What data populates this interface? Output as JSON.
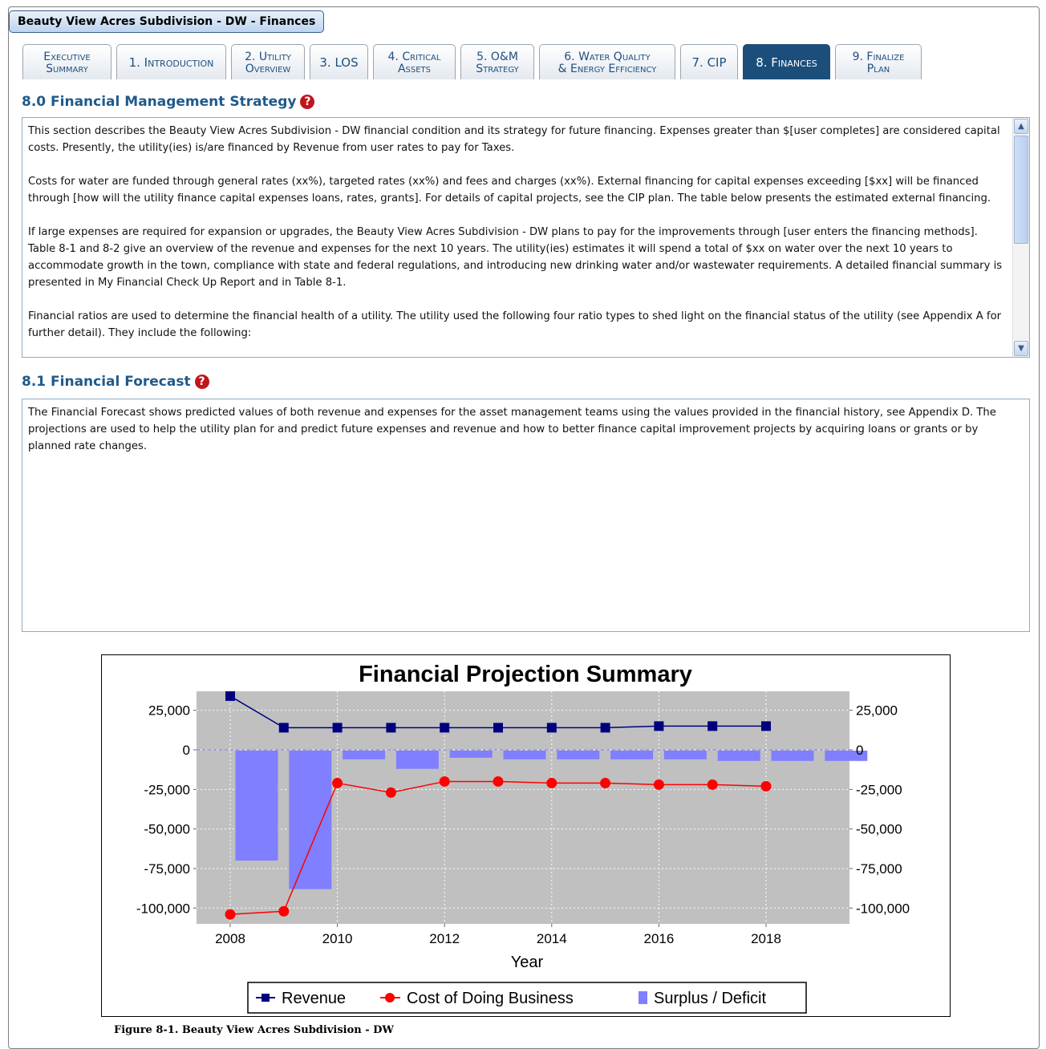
{
  "window": {
    "title": "Beauty View Acres Subdivision - DW - Finances"
  },
  "tabs": [
    {
      "line1": "Executive",
      "line2": "Summary"
    },
    {
      "line1": "1. Introduction",
      "line2": ""
    },
    {
      "line1": "2. Utility",
      "line2": "Overview"
    },
    {
      "line1": "3. LOS",
      "line2": ""
    },
    {
      "line1": "4. Critical",
      "line2": "Assets"
    },
    {
      "line1": "5. O&M",
      "line2": "Strategy"
    },
    {
      "line1": "6. Water Quality",
      "line2": "& Energy Efficiency"
    },
    {
      "line1": "7. CIP",
      "line2": ""
    },
    {
      "line1": "8. Finances",
      "line2": ""
    },
    {
      "line1": "9. Finalize",
      "line2": "Plan"
    }
  ],
  "active_tab": "8. Finances",
  "section_80": {
    "heading": "8.0 Financial Management Strategy",
    "paragraphs": [
      "This section describes the Beauty View Acres Subdivision - DW financial condition and its strategy for future financing. Expenses greater than $[user completes] are considered capital costs. Presently, the utility(ies) is/are financed by Revenue from user rates to pay for Taxes.",
      "Costs for water are funded through general rates (xx%), targeted rates (xx%) and fees and charges (xx%). External financing for capital expenses exceeding [$xx] will be financed through [how will the utility finance capital expenses loans, rates, grants]. For details of capital projects, see the CIP plan. The table below presents the estimated external financing.",
      "If large expenses are required for expansion or upgrades, the Beauty View Acres Subdivision - DW plans to pay for the improvements through [user enters the financing methods]. Table 8-1 and 8-2 give an overview of the revenue and expenses for the next 10 years. The utility(ies) estimates it will spend a total of $xx on water over the next 10 years to accommodate growth in the town, compliance with state and federal regulations, and introducing new drinking water and/or wastewater requirements. A detailed financial summary is presented in My Financial Check Up Report and in Table 8-1.",
      "Financial ratios are used to determine the financial health of a utility. The utility used the following four ratio types to shed light on the financial status of the utility (see Appendix A for further detail). They include the following:"
    ]
  },
  "section_81": {
    "heading": "8.1 Financial Forecast",
    "paragraph": "The Financial Forecast shows predicted values of both revenue and expenses for the asset management teams using the values provided in the financial history, see Appendix D. The projections are used to help the utility plan for and predict future expenses and revenue and how to better finance capital improvement projects by acquiring loans or grants or by planned rate changes."
  },
  "chart_data": {
    "type": "line",
    "title": "Financial Projection Summary",
    "xlabel": "Year",
    "ylabel": "",
    "xlim": [
      2008,
      2019.3
    ],
    "ylim": [
      -110000,
      37000
    ],
    "x_ticks": [
      2008,
      2010,
      2012,
      2014,
      2016,
      2018
    ],
    "y_ticks": [
      25000,
      0,
      -25000,
      -50000,
      -75000,
      -100000
    ],
    "y_tick_labels": [
      "25,000",
      "0",
      "-25,000",
      "-50,000",
      "-75,000",
      "-100,000"
    ],
    "secondary_y_axis": true,
    "grid": true,
    "plot_background": "#c0c0c0",
    "legend_position": "bottom",
    "series": [
      {
        "name": "Revenue",
        "kind": "line",
        "marker": "square",
        "color": "#00007f",
        "x": [
          2008,
          2009,
          2010,
          2011,
          2012,
          2013,
          2014,
          2015,
          2016,
          2017,
          2018
        ],
        "values": [
          34000,
          14000,
          14000,
          14000,
          14000,
          14000,
          14000,
          14000,
          15000,
          15000,
          15000
        ]
      },
      {
        "name": "Cost of Doing Business",
        "kind": "line",
        "marker": "circle",
        "color": "#ff0000",
        "x": [
          2008,
          2009,
          2010,
          2011,
          2012,
          2013,
          2014,
          2015,
          2016,
          2017,
          2018
        ],
        "values": [
          -104000,
          -102000,
          -21000,
          -27000,
          -20000,
          -20000,
          -21000,
          -21000,
          -22000,
          -22000,
          -23000
        ]
      },
      {
        "name": "Surplus / Deficit",
        "kind": "bar",
        "color": "#7f7fff",
        "x": [
          2008,
          2009,
          2010,
          2011,
          2012,
          2013,
          2014,
          2015,
          2016,
          2017,
          2018,
          2019
        ],
        "values": [
          -70000,
          -88000,
          -6000,
          -12000,
          -5000,
          -6000,
          -6000,
          -6000,
          -6000,
          -7000,
          -7000,
          -7000
        ]
      }
    ]
  },
  "figure_caption": "Figure 8-1. Beauty View Acres Subdivision - DW"
}
